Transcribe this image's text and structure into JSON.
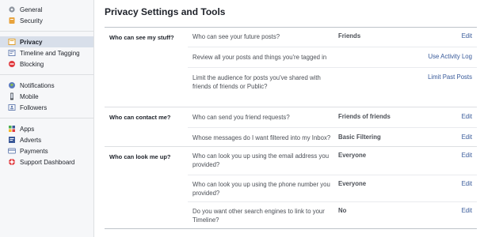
{
  "sidebar": {
    "group1": [
      {
        "label": "General",
        "icon": "gear-icon"
      },
      {
        "label": "Security",
        "icon": "badge-icon"
      }
    ],
    "group2": [
      {
        "label": "Privacy",
        "icon": "lock-icon",
        "active": true
      },
      {
        "label": "Timeline and Tagging",
        "icon": "timeline-icon"
      },
      {
        "label": "Blocking",
        "icon": "blocking-icon"
      }
    ],
    "group3": [
      {
        "label": "Notifications",
        "icon": "globe-icon"
      },
      {
        "label": "Mobile",
        "icon": "mobile-icon"
      },
      {
        "label": "Followers",
        "icon": "followers-icon"
      }
    ],
    "group4": [
      {
        "label": "Apps",
        "icon": "apps-icon"
      },
      {
        "label": "Adverts",
        "icon": "adverts-icon"
      },
      {
        "label": "Payments",
        "icon": "payments-icon"
      },
      {
        "label": "Support Dashboard",
        "icon": "support-icon"
      }
    ]
  },
  "main": {
    "title": "Privacy Settings and Tools",
    "sections": [
      {
        "title": "Who can see my stuff?",
        "rows": [
          {
            "question": "Who can see your future posts?",
            "value": "Friends",
            "action": "Edit"
          },
          {
            "question": "Review all your posts and things you're tagged in",
            "value": "",
            "action": "Use Activity Log"
          },
          {
            "question": "Limit the audience for posts you've shared with friends of friends or Public?",
            "value": "",
            "action": "Limit Past Posts"
          }
        ]
      },
      {
        "title": "Who can contact me?",
        "rows": [
          {
            "question": "Who can send you friend requests?",
            "value": "Friends of friends",
            "action": "Edit"
          },
          {
            "question": "Whose messages do I want filtered into my Inbox?",
            "value": "Basic Filtering",
            "action": "Edit"
          }
        ]
      },
      {
        "title": "Who can look me up?",
        "rows": [
          {
            "question": "Who can look you up using the email address you provided?",
            "value": "Everyone",
            "action": "Edit"
          },
          {
            "question": "Who can look you up using the phone number you provided?",
            "value": "Everyone",
            "action": "Edit"
          },
          {
            "question": "Do you want other search engines to link to your Timeline?",
            "value": "No",
            "action": "Edit"
          }
        ]
      }
    ]
  },
  "colors": {
    "link": "#365899",
    "active_bg": "#d8dfea",
    "sidebar_bg": "#f6f7f9"
  }
}
